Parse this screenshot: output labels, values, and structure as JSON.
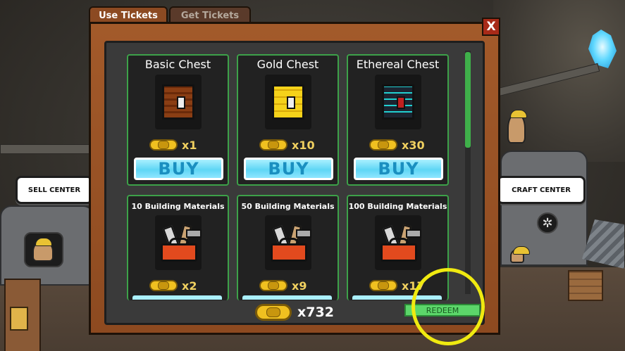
{
  "tabs": [
    {
      "label": "Use Tickets",
      "active": true
    },
    {
      "label": "Get Tickets",
      "active": false
    }
  ],
  "close_label": "X",
  "background": {
    "sell_center_label": "SELL CENTER",
    "craft_center_label": "CRAFT CENTER"
  },
  "items": [
    {
      "title": "Basic Chest",
      "price": "x1",
      "button": "BUY",
      "art": "chest-basic-icon"
    },
    {
      "title": "Gold Chest",
      "price": "x10",
      "button": "BUY",
      "art": "chest-gold-icon"
    },
    {
      "title": "Ethereal Chest",
      "price": "x30",
      "button": "BUY",
      "art": "chest-ethereal-icon"
    },
    {
      "title": "10 Building Materials",
      "price": "x2",
      "art": "toolbox-icon"
    },
    {
      "title": "50 Building Materials",
      "price": "x9",
      "art": "toolbox-icon"
    },
    {
      "title": "100 Building Materials",
      "price": "x17",
      "art": "toolbox-icon"
    }
  ],
  "footer": {
    "ticket_count": "x732",
    "redeem_label": "REDEEM"
  },
  "colors": {
    "panel": "#a35a2a",
    "card_border": "#3da149",
    "buy_button": "#5fd6f5",
    "redeem_button": "#5cd66a",
    "highlight": "#f0ea10"
  }
}
